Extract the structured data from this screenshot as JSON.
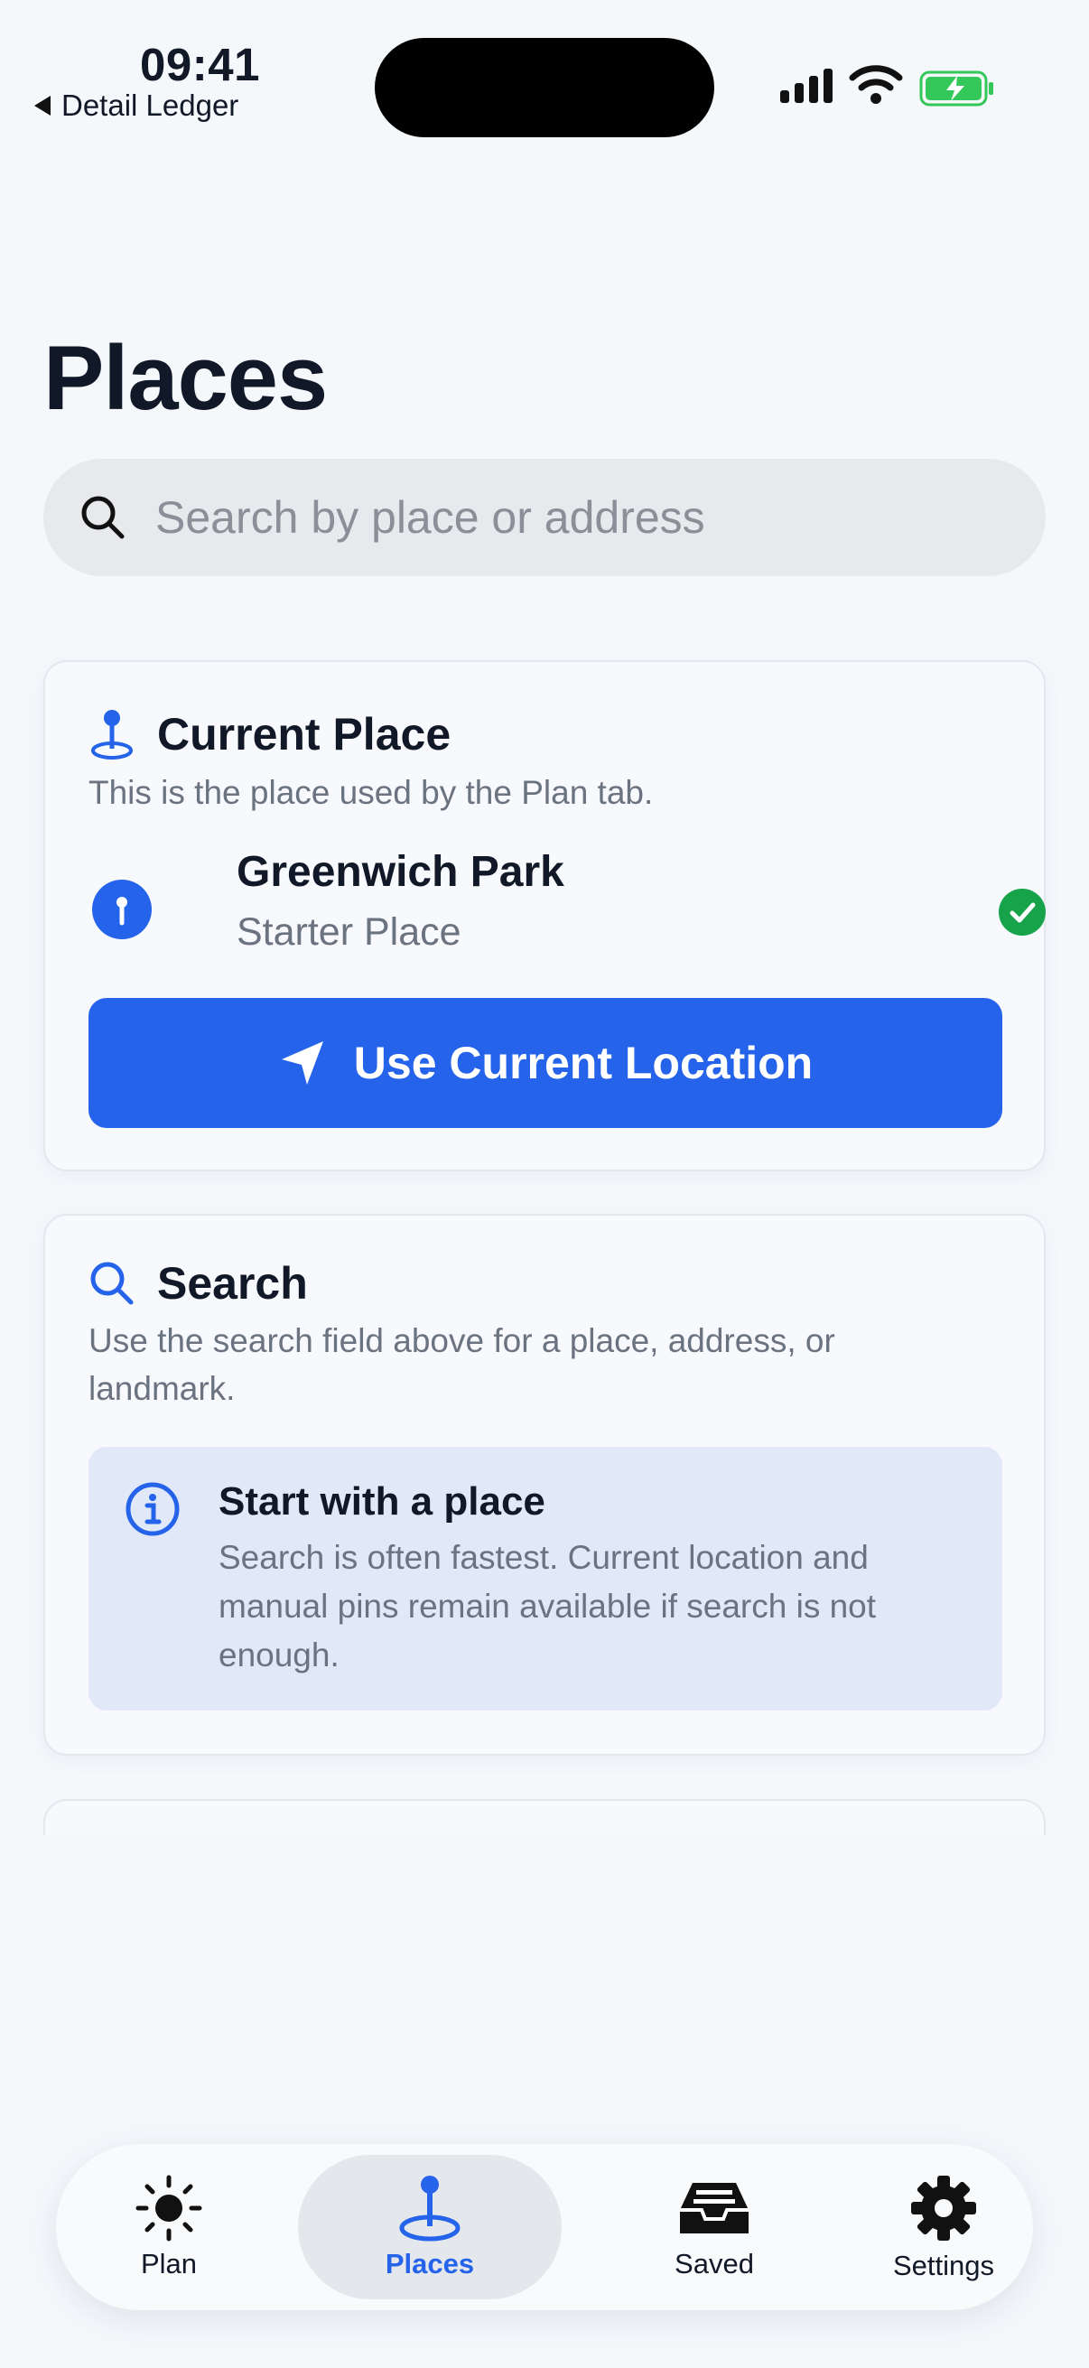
{
  "status_bar": {
    "time": "09:41",
    "back_label": "Detail Ledger"
  },
  "page": {
    "title": "Places"
  },
  "search": {
    "placeholder": "Search by place or address"
  },
  "current_place": {
    "title": "Current Place",
    "description": "This is the place used by the Plan tab.",
    "place_name": "Greenwich Park",
    "place_subtitle": "Starter Place",
    "button_label": "Use Current Location"
  },
  "search_card": {
    "title": "Search",
    "description": "Use the search field above for a place, address, or landmark.",
    "info_title": "Start with a place",
    "info_text": "Search is often fastest. Current location and manual pins remain available if search is not enough."
  },
  "tabs": [
    {
      "label": "Plan",
      "icon": "sun-icon"
    },
    {
      "label": "Places",
      "icon": "map-pin-icon",
      "active": true
    },
    {
      "label": "Saved",
      "icon": "inbox-tray-icon"
    },
    {
      "label": "Settings",
      "icon": "gear-icon"
    }
  ],
  "colors": {
    "accent": "#2563eb",
    "success": "#16a34a",
    "info_bg": "#e1e9f8",
    "battery": "#34c759"
  }
}
